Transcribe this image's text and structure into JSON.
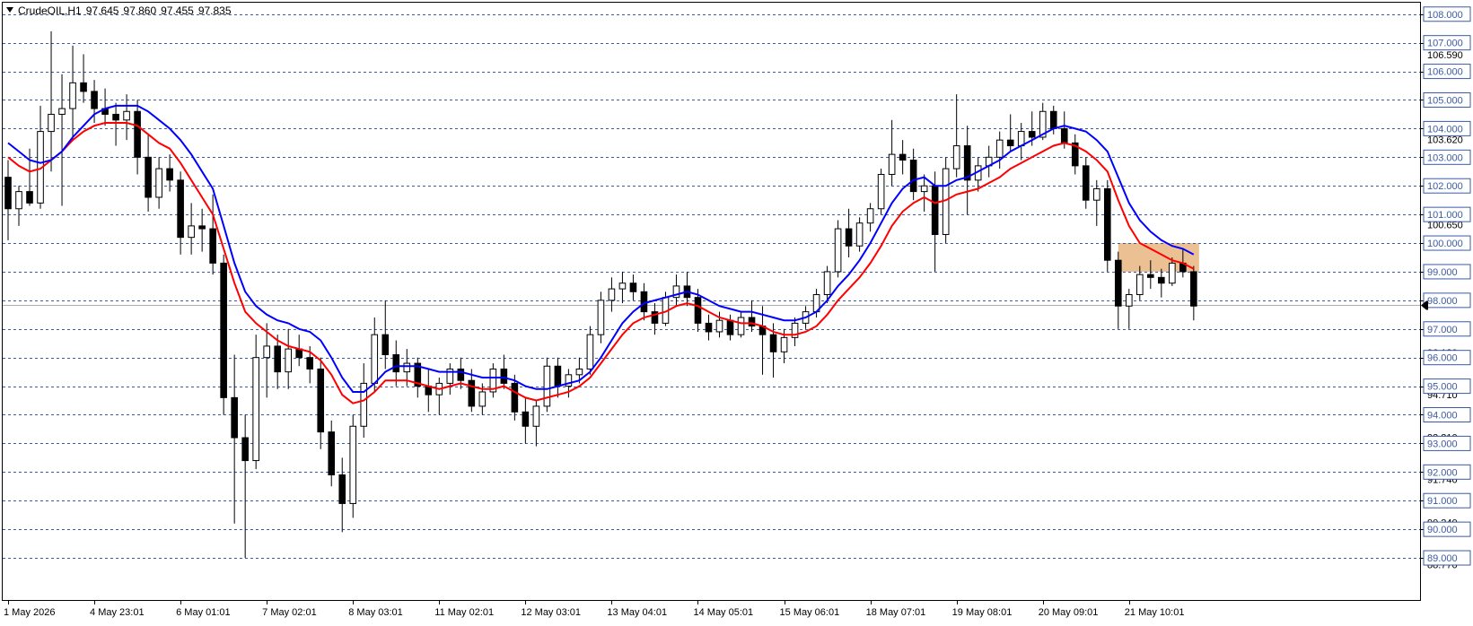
{
  "header": {
    "symbol": "CrudeOIL",
    "timeframe": "H1",
    "open": "97.645",
    "high": "97.860",
    "low": "97.455",
    "close": "97.835"
  },
  "colors": {
    "background": "#ffffff",
    "grid": "#3b5ba5",
    "candle": "#000000",
    "ma_fast": "#ff0000",
    "ma_slow": "#0000ff",
    "zone": "#e8b57f",
    "price_label_bg": "#ffffff"
  },
  "chart_data": {
    "type": "candlestick",
    "grid": true,
    "ylim": [
      88.5,
      108.4
    ],
    "xlim": [
      0,
      131
    ],
    "y_ticks": [
      "108.000",
      "107.000",
      "106.000",
      "105.000",
      "104.000",
      "103.000",
      "102.000",
      "101.000",
      "100.000",
      "99.000",
      "98.000",
      "97.000",
      "96.000",
      "95.000",
      "94.000",
      "93.000",
      "92.000",
      "91.000",
      "90.000",
      "89.000"
    ],
    "y_tick_values": [
      108,
      107,
      106,
      105,
      104,
      103,
      102,
      101,
      100,
      99,
      98,
      97,
      96,
      95,
      94,
      93,
      92,
      91,
      90,
      89
    ],
    "y_minor_labels": [
      {
        "label": "106.590",
        "value": 106.59
      },
      {
        "label": "103.620",
        "value": 103.62
      },
      {
        "label": "100.650",
        "value": 100.65
      },
      {
        "label": "96.180",
        "value": 96.18
      },
      {
        "label": "94.710",
        "value": 94.71
      },
      {
        "label": "93.210",
        "value": 93.21
      },
      {
        "label": "91.740",
        "value": 91.74
      },
      {
        "label": "90.240",
        "value": 90.24
      },
      {
        "label": "88.770",
        "value": 88.77
      }
    ],
    "current_price": 97.835,
    "x_labels": [
      {
        "label": "1 May 2026",
        "index": 0
      },
      {
        "label": "4 May 23:01",
        "index": 8
      },
      {
        "label": "6 May 01:01",
        "index": 16
      },
      {
        "label": "7 May 02:01",
        "index": 24
      },
      {
        "label": "8 May 03:01",
        "index": 32
      },
      {
        "label": "11 May 02:01",
        "index": 40
      },
      {
        "label": "12 May 03:01",
        "index": 48
      },
      {
        "label": "13 May 04:01",
        "index": 56
      },
      {
        "label": "14 May 05:01",
        "index": 64
      },
      {
        "label": "15 May 06:01",
        "index": 72
      },
      {
        "label": "18 May 07:01",
        "index": 80
      },
      {
        "label": "19 May 08:01",
        "index": 88
      },
      {
        "label": "20 May 09:01",
        "index": 96
      },
      {
        "label": "21 May 10:01",
        "index": 104
      }
    ],
    "candles": [
      [
        102.3,
        102.9,
        100.1,
        101.2
      ],
      [
        101.2,
        102.0,
        100.6,
        101.8
      ],
      [
        101.8,
        103.3,
        101.3,
        101.4
      ],
      [
        101.4,
        104.8,
        101.2,
        103.9
      ],
      [
        103.9,
        107.4,
        102.5,
        104.5
      ],
      [
        104.5,
        105.9,
        101.3,
        104.7
      ],
      [
        104.7,
        106.9,
        103.6,
        105.6
      ],
      [
        105.6,
        106.6,
        104.9,
        105.3
      ],
      [
        105.3,
        105.7,
        104.2,
        104.7
      ],
      [
        104.7,
        105.4,
        104.1,
        104.5
      ],
      [
        104.5,
        104.9,
        103.4,
        104.3
      ],
      [
        104.3,
        105.2,
        103.6,
        104.6
      ],
      [
        104.6,
        105.0,
        102.4,
        103.0
      ],
      [
        103.0,
        103.8,
        101.1,
        101.6
      ],
      [
        101.6,
        103.0,
        101.2,
        102.6
      ],
      [
        102.6,
        103.1,
        101.8,
        102.2
      ],
      [
        102.2,
        102.5,
        99.6,
        100.2
      ],
      [
        100.2,
        101.4,
        99.6,
        100.6
      ],
      [
        100.6,
        101.2,
        99.7,
        100.5
      ],
      [
        100.5,
        101.7,
        98.9,
        99.3
      ],
      [
        99.3,
        99.6,
        94.0,
        94.6
      ],
      [
        94.6,
        96.1,
        90.2,
        93.2
      ],
      [
        93.2,
        94.0,
        89.0,
        92.4
      ],
      [
        92.4,
        96.8,
        92.1,
        96.0
      ],
      [
        96.0,
        97.2,
        94.6,
        96.4
      ],
      [
        96.4,
        96.8,
        94.9,
        95.5
      ],
      [
        95.5,
        97.0,
        94.9,
        96.3
      ],
      [
        96.3,
        96.8,
        95.7,
        96.0
      ],
      [
        96.0,
        96.4,
        95.1,
        95.6
      ],
      [
        95.6,
        96.0,
        92.8,
        93.4
      ],
      [
        93.4,
        93.8,
        91.5,
        91.9
      ],
      [
        91.9,
        92.5,
        89.9,
        90.9
      ],
      [
        90.9,
        94.0,
        90.4,
        93.6
      ],
      [
        93.6,
        95.8,
        93.2,
        95.1
      ],
      [
        95.1,
        97.4,
        94.8,
        96.8
      ],
      [
        96.8,
        98.0,
        95.6,
        96.1
      ],
      [
        96.1,
        96.6,
        95.0,
        95.5
      ],
      [
        95.5,
        96.3,
        95.0,
        95.8
      ],
      [
        95.8,
        96.0,
        94.6,
        95.0
      ],
      [
        95.0,
        95.6,
        94.1,
        94.7
      ],
      [
        94.7,
        95.3,
        94.0,
        95.1
      ],
      [
        95.1,
        95.8,
        94.7,
        95.6
      ],
      [
        95.6,
        96.0,
        94.9,
        95.2
      ],
      [
        95.2,
        95.6,
        94.1,
        94.3
      ],
      [
        94.3,
        95.1,
        94.0,
        94.8
      ],
      [
        94.8,
        95.8,
        94.6,
        95.6
      ],
      [
        95.6,
        96.1,
        94.9,
        95.1
      ],
      [
        95.1,
        95.4,
        93.8,
        94.1
      ],
      [
        94.1,
        94.6,
        93.0,
        93.6
      ],
      [
        93.6,
        94.5,
        92.9,
        94.3
      ],
      [
        94.3,
        96.0,
        94.1,
        95.7
      ],
      [
        95.7,
        96.0,
        94.6,
        95.0
      ],
      [
        95.0,
        95.6,
        94.6,
        95.4
      ],
      [
        95.4,
        96.0,
        95.1,
        95.6
      ],
      [
        95.6,
        97.1,
        95.4,
        96.8
      ],
      [
        96.8,
        98.3,
        96.5,
        98.0
      ],
      [
        98.0,
        98.8,
        97.6,
        98.4
      ],
      [
        98.4,
        99.0,
        97.9,
        98.6
      ],
      [
        98.6,
        98.9,
        98.0,
        98.3
      ],
      [
        98.3,
        98.6,
        97.3,
        97.6
      ],
      [
        97.6,
        97.9,
        96.8,
        97.2
      ],
      [
        97.2,
        98.3,
        97.1,
        98.1
      ],
      [
        98.1,
        98.9,
        97.8,
        98.5
      ],
      [
        98.5,
        99.0,
        97.8,
        98.1
      ],
      [
        98.1,
        98.4,
        96.9,
        97.2
      ],
      [
        97.2,
        97.5,
        96.6,
        96.9
      ],
      [
        96.9,
        97.6,
        96.7,
        97.3
      ],
      [
        97.3,
        97.5,
        96.6,
        96.8
      ],
      [
        96.8,
        97.6,
        96.7,
        97.4
      ],
      [
        97.4,
        98.0,
        96.9,
        97.1
      ],
      [
        97.1,
        97.8,
        95.4,
        96.8
      ],
      [
        96.8,
        97.2,
        95.3,
        96.2
      ],
      [
        96.2,
        97.0,
        95.8,
        96.7
      ],
      [
        96.7,
        97.4,
        96.4,
        97.2
      ],
      [
        97.2,
        97.8,
        97.0,
        97.6
      ],
      [
        97.6,
        98.4,
        97.4,
        98.2
      ],
      [
        98.2,
        99.2,
        97.9,
        99.0
      ],
      [
        99.0,
        100.8,
        98.8,
        100.5
      ],
      [
        100.5,
        101.2,
        99.5,
        99.9
      ],
      [
        99.9,
        100.9,
        99.7,
        100.7
      ],
      [
        100.7,
        101.4,
        100.4,
        101.2
      ],
      [
        101.2,
        102.6,
        101.0,
        102.4
      ],
      [
        102.4,
        104.3,
        102.0,
        103.1
      ],
      [
        103.1,
        103.6,
        102.4,
        102.9
      ],
      [
        102.9,
        103.3,
        101.5,
        101.8
      ],
      [
        101.8,
        102.4,
        101.1,
        102.0
      ],
      [
        102.0,
        102.5,
        99.0,
        100.3
      ],
      [
        100.3,
        103.0,
        100.0,
        102.6
      ],
      [
        102.6,
        105.2,
        102.3,
        103.4
      ],
      [
        103.4,
        104.1,
        101.0,
        102.2
      ],
      [
        102.2,
        103.0,
        101.8,
        102.7
      ],
      [
        102.7,
        103.4,
        102.3,
        103.0
      ],
      [
        103.0,
        103.9,
        102.6,
        103.6
      ],
      [
        103.6,
        104.5,
        103.2,
        103.4
      ],
      [
        103.4,
        104.2,
        102.9,
        103.9
      ],
      [
        103.9,
        104.6,
        103.4,
        103.7
      ],
      [
        103.7,
        104.9,
        103.6,
        104.6
      ],
      [
        104.6,
        104.8,
        103.8,
        104.0
      ],
      [
        104.0,
        104.6,
        103.3,
        103.5
      ],
      [
        103.5,
        103.8,
        102.4,
        102.7
      ],
      [
        102.7,
        103.0,
        101.2,
        101.5
      ],
      [
        101.5,
        102.2,
        100.6,
        101.9
      ],
      [
        101.9,
        102.2,
        99.0,
        99.4
      ],
      [
        99.4,
        99.7,
        97.0,
        97.8
      ],
      [
        97.8,
        98.4,
        97.0,
        98.2
      ],
      [
        98.2,
        99.2,
        98.0,
        98.9
      ],
      [
        98.9,
        99.4,
        98.4,
        98.8
      ],
      [
        98.8,
        99.1,
        98.1,
        98.6
      ],
      [
        98.6,
        99.5,
        98.5,
        99.3
      ],
      [
        99.3,
        99.8,
        98.8,
        99.0
      ],
      [
        99.0,
        99.2,
        97.3,
        97.8
      ]
    ],
    "series": [
      {
        "values": [
          103.0,
          102.7,
          102.5,
          102.6,
          102.9,
          103.2,
          103.6,
          103.9,
          104.1,
          104.2,
          104.2,
          104.2,
          104.1,
          103.8,
          103.5,
          103.3,
          102.8,
          102.2,
          101.6,
          101.0,
          99.8,
          98.6,
          97.6,
          97.2,
          96.9,
          96.6,
          96.4,
          96.3,
          96.2,
          95.9,
          95.4,
          94.7,
          94.4,
          94.5,
          94.8,
          95.2,
          95.2,
          95.2,
          95.1,
          95.0,
          94.9,
          95.0,
          95.1,
          95.0,
          94.9,
          94.9,
          95.0,
          94.8,
          94.6,
          94.5,
          94.6,
          94.7,
          94.8,
          95.0,
          95.3,
          95.8,
          96.3,
          96.8,
          97.2,
          97.4,
          97.5,
          97.6,
          97.8,
          97.9,
          97.8,
          97.6,
          97.4,
          97.3,
          97.2,
          97.2,
          97.1,
          96.9,
          96.8,
          96.8,
          96.9,
          97.1,
          97.5,
          98.0,
          98.4,
          98.8,
          99.3,
          99.9,
          100.6,
          101.1,
          101.4,
          101.6,
          101.4,
          101.5,
          101.7,
          101.8,
          101.9,
          102.1,
          102.3,
          102.6,
          102.8,
          103.0,
          103.2,
          103.4,
          103.5,
          103.4,
          103.2,
          102.9,
          102.5,
          101.5,
          100.6,
          100.0,
          99.8,
          99.6,
          99.4,
          99.3,
          99.1
        ],
        "color": "#ff0000"
      },
      {
        "values": [
          103.5,
          103.2,
          102.9,
          102.8,
          102.9,
          103.2,
          103.7,
          104.1,
          104.5,
          104.7,
          104.8,
          104.8,
          104.8,
          104.6,
          104.3,
          104.0,
          103.6,
          103.1,
          102.5,
          101.9,
          100.6,
          99.3,
          98.3,
          97.8,
          97.5,
          97.3,
          97.2,
          97.0,
          96.9,
          96.6,
          96.0,
          95.3,
          94.8,
          94.8,
          95.1,
          95.5,
          95.7,
          95.7,
          95.7,
          95.6,
          95.5,
          95.5,
          95.5,
          95.4,
          95.3,
          95.3,
          95.3,
          95.2,
          95.0,
          94.9,
          94.9,
          95.0,
          95.1,
          95.2,
          95.5,
          96.0,
          96.6,
          97.2,
          97.6,
          97.9,
          98.0,
          98.1,
          98.2,
          98.3,
          98.2,
          98.0,
          97.8,
          97.7,
          97.6,
          97.6,
          97.5,
          97.4,
          97.3,
          97.3,
          97.4,
          97.6,
          98.0,
          98.5,
          98.9,
          99.4,
          100.0,
          100.7,
          101.4,
          101.9,
          102.2,
          102.3,
          102.0,
          102.0,
          102.2,
          102.3,
          102.5,
          102.7,
          102.9,
          103.2,
          103.4,
          103.6,
          103.8,
          104.0,
          104.1,
          104.0,
          103.9,
          103.6,
          103.2,
          102.3,
          101.4,
          100.8,
          100.4,
          100.1,
          99.9,
          99.8,
          99.6
        ],
        "color": "#0000ff"
      }
    ],
    "zone": {
      "start_index": 103,
      "end_index": 110.5,
      "low": 99.0,
      "high": 100.0
    }
  }
}
